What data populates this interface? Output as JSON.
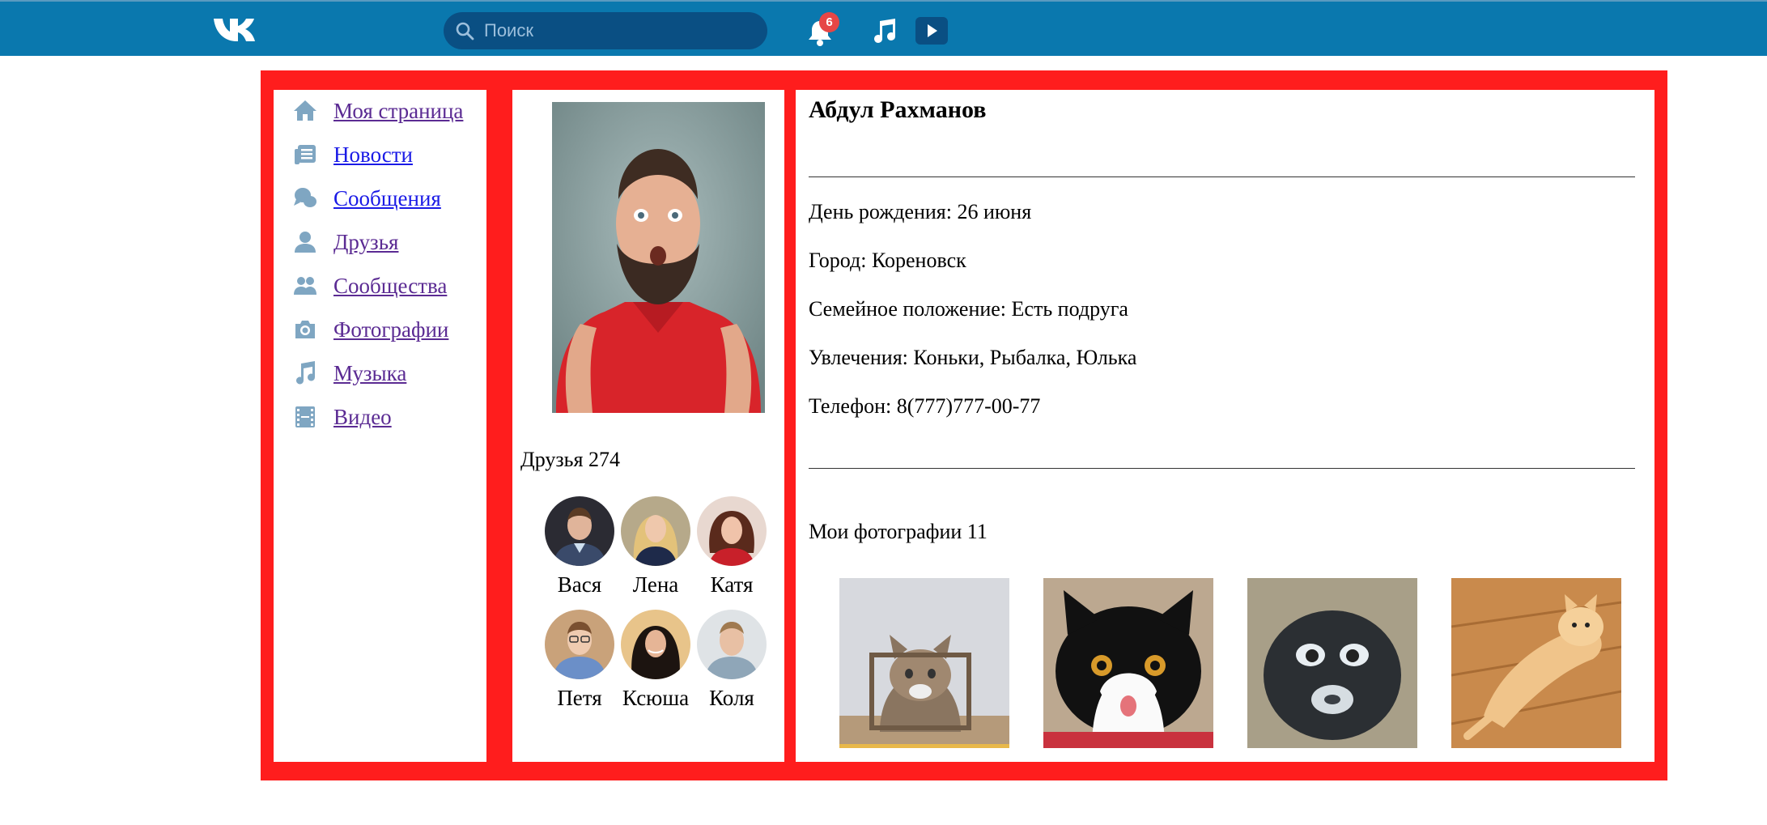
{
  "topbar": {
    "search_placeholder": "Поиск",
    "notifications_count": "6",
    "brand_color": "#0a78ae"
  },
  "nav": {
    "items": [
      {
        "label": "Моя страница",
        "icon": "home-icon"
      },
      {
        "label": "Новости",
        "icon": "news-icon"
      },
      {
        "label": "Сообщения",
        "icon": "messages-icon"
      },
      {
        "label": "Друзья",
        "icon": "friends-icon"
      },
      {
        "label": "Сообщества",
        "icon": "communities-icon"
      },
      {
        "label": "Фотографии",
        "icon": "camera-icon"
      },
      {
        "label": "Музыка",
        "icon": "music-icon"
      },
      {
        "label": "Видео",
        "icon": "film-icon"
      }
    ]
  },
  "friends": {
    "title": "Друзья 274",
    "list": [
      "Вася",
      "Лена",
      "Катя",
      "Петя",
      "Ксюша",
      "Коля"
    ]
  },
  "profile": {
    "name": "Абдул Рахманов",
    "birthday": "День рождения: 26 июня",
    "city": "Город: Кореновск",
    "status": "Семейное положение: Есть подруга",
    "hobbies": "Увлечения: Коньки, Рыбалка, Юлька",
    "phone": "Телефон: 8(777)777-00-77"
  },
  "photos": {
    "title": "Мои фотографии 11"
  },
  "colors": {
    "frame": "#ff1d1d",
    "icon": "#7fa6c2"
  }
}
